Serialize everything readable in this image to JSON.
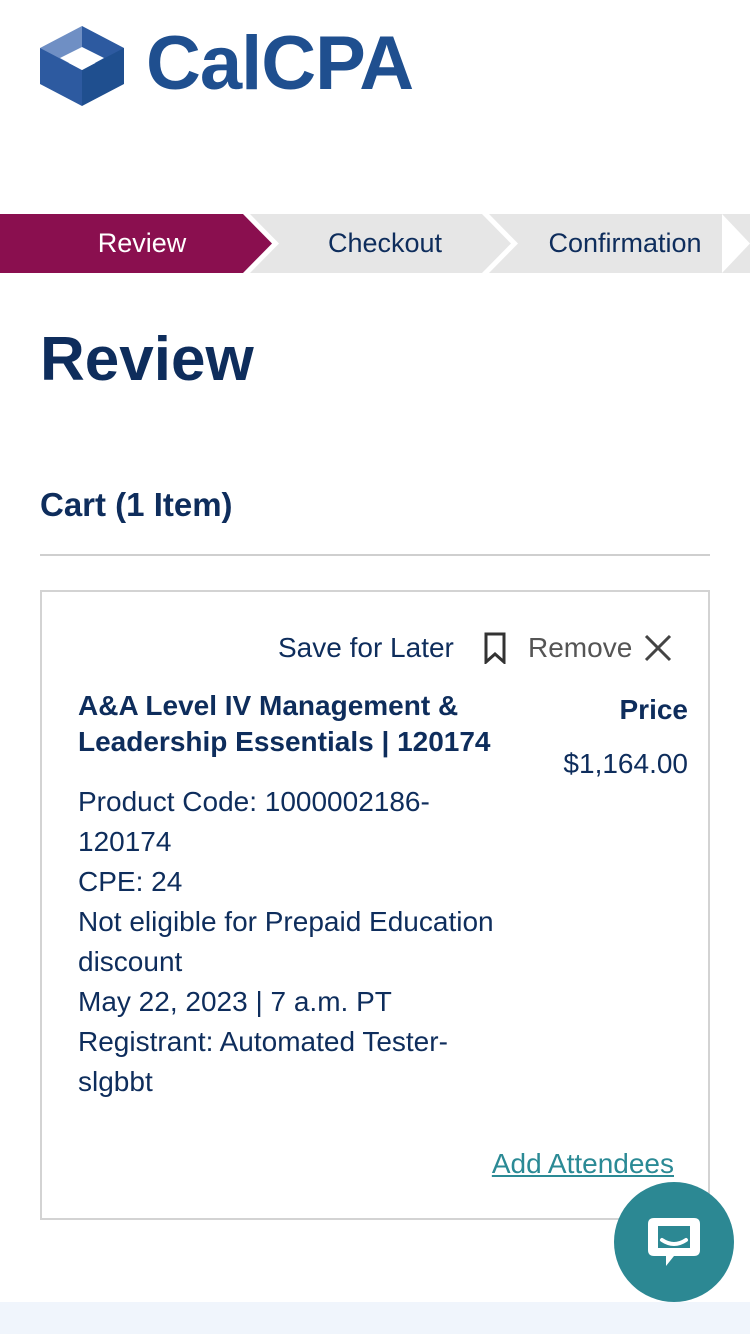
{
  "brand": {
    "name": "CalCPA",
    "primary_color": "#1f4f8f",
    "accent_color": "#8a0f4f",
    "link_color": "#2b8a95"
  },
  "steps": [
    {
      "label": "Review",
      "state": "active"
    },
    {
      "label": "Checkout",
      "state": "inactive"
    },
    {
      "label": "Confirmation",
      "state": "inactive"
    }
  ],
  "page": {
    "title": "Review"
  },
  "cart": {
    "heading": "Cart (1 Item)",
    "item": {
      "save_for_later_label": "Save for Later",
      "save_icon": "bookmark-icon",
      "remove_label": "Remove",
      "remove_icon": "close-icon",
      "title": "A&A Level IV Management & Leadership Essentials | 120174",
      "price_label": "Price",
      "price": "$1,164.00",
      "product_code": "Product Code: 1000002186-120174",
      "cpe": "CPE: 24",
      "discount_note": "Not eligible for Prepaid Education discount",
      "date_time": "May 22, 2023 | 7 a.m. PT",
      "registrant": "Registrant: Automated Tester-slgbbt",
      "add_attendees_label": "Add Attendees"
    }
  },
  "chat": {
    "icon": "chat-bubble-icon"
  }
}
